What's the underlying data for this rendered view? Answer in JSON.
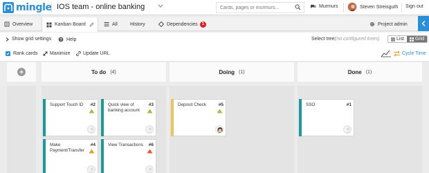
{
  "header": {
    "logo_text": "mingle",
    "project_title": "IOS team - online banking",
    "search_placeholder": "Cards, pages or murmurs...",
    "murmurs_label": "Murmurs",
    "user_name": "Steven Streisguth",
    "signout_label": "Sign out"
  },
  "tabs": [
    {
      "label": "Overview"
    },
    {
      "label": "Kanban Board"
    },
    {
      "label": "All"
    },
    {
      "label": "History"
    },
    {
      "label": "Dependencies",
      "badge": "1"
    }
  ],
  "project_admin_label": "Project admin",
  "toolbar": {
    "show_grid_settings": "Show grid settings",
    "help": "Help",
    "select_tree_label": "Select tree:",
    "tree_value": "(no configured trees)",
    "view_list": "List",
    "view_grid": "Grid",
    "rank_cards": "Rank cards",
    "maximize": "Maximize",
    "update_url": "Update URL",
    "cycle_time": "Cycle Time"
  },
  "columns": [
    {
      "name": "To do",
      "count": "(4)"
    },
    {
      "name": "Doing",
      "count": "(1)"
    },
    {
      "name": "Done",
      "count": "(1)"
    }
  ],
  "cards": [
    {
      "name": "Support Touch ID",
      "number": "#2",
      "color": "#1b9a9a",
      "priority": "low"
    },
    {
      "name": "Quick view of banking account",
      "number": "#3",
      "color": "#1b9a9a",
      "priority": "low"
    },
    {
      "name": "Make Payment/Transfer",
      "number": "#4",
      "color": "#1b9a9a",
      "priority": "medium"
    },
    {
      "name": "View Transactions",
      "number": "#6",
      "color": "#1b9a9a",
      "priority": "high"
    },
    {
      "name": "Deposit Check",
      "number": "#5",
      "color": "#e8c75a",
      "priority": "low"
    },
    {
      "name": "SSO",
      "number": "#1",
      "color": "#1b9a9a",
      "priority": "none"
    }
  ],
  "colors": {
    "accent": "#2a8fd6",
    "low_priority": "#a0c23a",
    "medium_priority": "#e0a020",
    "high_priority": "#e8582a"
  }
}
